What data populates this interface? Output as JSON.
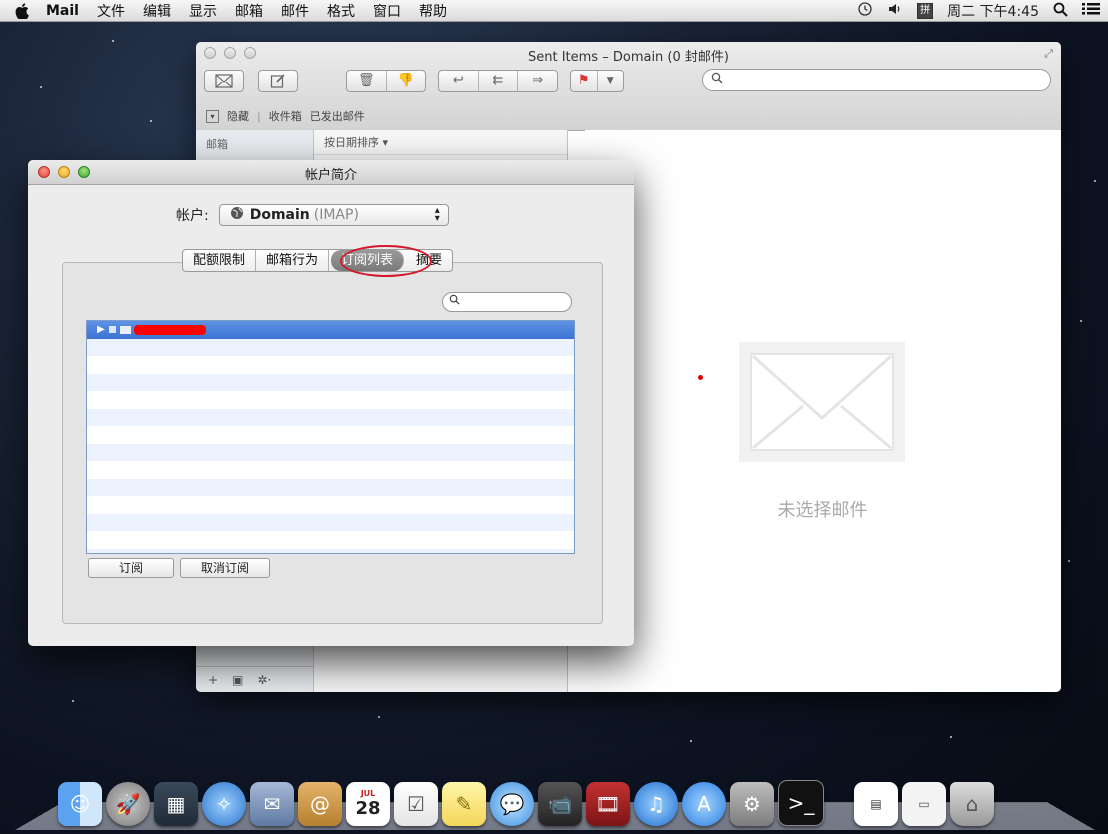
{
  "menubar": {
    "app_name": "Mail",
    "items": [
      "文件",
      "编辑",
      "显示",
      "邮箱",
      "邮件",
      "格式",
      "窗口",
      "帮助"
    ],
    "ime": "拼",
    "clock": "周二 下午4:45"
  },
  "mail_window": {
    "title": "Sent Items – Domain (0 封邮件)",
    "search_placeholder": "",
    "favorites": {
      "hide": "隐藏",
      "inbox": "收件箱",
      "sent": "已发出邮件"
    },
    "sidebar_header": "邮箱",
    "sort_label": "按日期排序 ▾",
    "no_message": "未选择邮件"
  },
  "dialog": {
    "title": "帐户简介",
    "account_label": "帐户:",
    "account_name": "Domain",
    "account_type": "(IMAP)",
    "tabs": [
      {
        "label": "配额限制"
      },
      {
        "label": "邮箱行为"
      },
      {
        "label": "订阅列表"
      },
      {
        "label": "摘要"
      }
    ],
    "active_tab": "订阅列表",
    "search_placeholder": "",
    "subscribe_button": "订阅",
    "unsubscribe_button": "取消订阅"
  },
  "dock": {
    "calendar_day": "28",
    "calendar_month": "JUL"
  },
  "colors": {
    "selection": "#3c73d3",
    "annotation": "#d2182a",
    "redaction": "#ff0000"
  }
}
